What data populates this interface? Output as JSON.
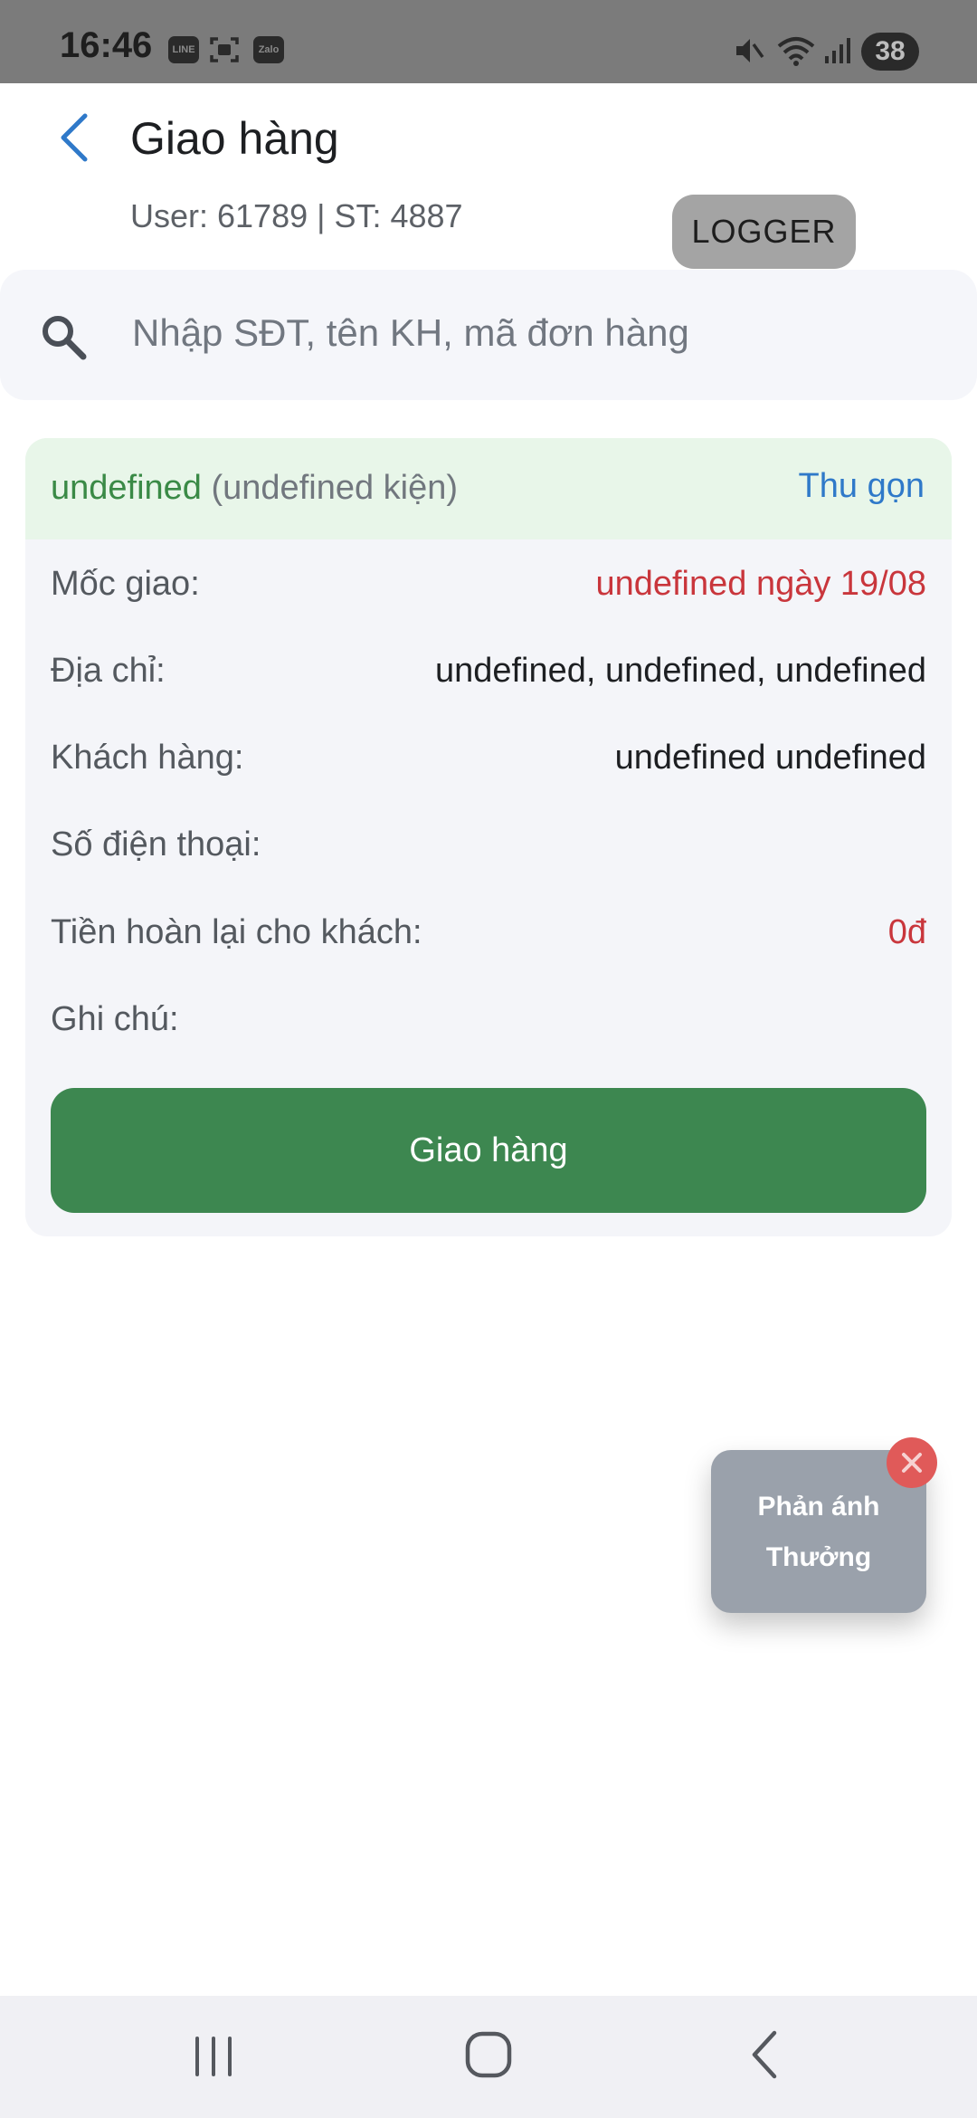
{
  "status_bar": {
    "time": "16:46",
    "left_icons": [
      "line-app-icon",
      "screenshot-icon",
      "zalo-app-icon"
    ],
    "line_label": "LINE",
    "zalo_label": "Zalo",
    "right_icons": [
      "mute-icon",
      "wifi-icon",
      "signal-icon"
    ],
    "battery_level": "38"
  },
  "header": {
    "back_icon": "chevron-left-icon",
    "title": "Giao hàng",
    "subtitle": "User: 61789 | ST: 4887",
    "logger_label": "LOGGER"
  },
  "search": {
    "icon": "search-icon",
    "placeholder": "Nhập SĐT, tên KH, mã đơn hàng",
    "value": ""
  },
  "order_card": {
    "name": "undefined",
    "packages": "(undefined kiện)",
    "collapse_label": "Thu gọn",
    "rows": [
      {
        "label": "Mốc giao:",
        "value": "undefined ngày 19/08"
      },
      {
        "label": "Địa chỉ:",
        "value": "undefined, undefined, undefined"
      },
      {
        "label": "Khách hàng:",
        "value": "undefined undefined"
      },
      {
        "label": "Số điện thoại:",
        "value": ""
      },
      {
        "label": "Tiền hoàn lại cho khách:",
        "value": "0đ"
      },
      {
        "label": "Ghi chú:",
        "value": ""
      }
    ],
    "deliver_button_label": "Giao hàng"
  },
  "floating_widget": {
    "line1": "Phản ánh",
    "line2": "Thưởng",
    "close_icon": "close-icon"
  },
  "nav_bar": {
    "icons": [
      "recent-apps-icon",
      "home-icon",
      "back-icon"
    ]
  },
  "colors": {
    "accent_green": "#3d8750",
    "link_blue": "#2f79c9",
    "alert_red": "#c9363c",
    "status_bar": "#7b7b7b",
    "card_bg": "#f4f5f9",
    "card_header_bg": "#e8f6e9"
  }
}
